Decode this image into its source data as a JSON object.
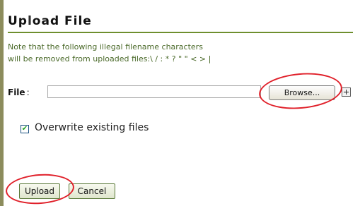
{
  "title": "Upload File",
  "note": {
    "line1": "Note that the following illegal filename characters",
    "line2": "will be removed from uploaded files:\\ / : * ? \" \" < > |"
  },
  "file": {
    "label": "File",
    "colon": ":",
    "value": "",
    "browse_label": "Browse..."
  },
  "overwrite": {
    "checked": true,
    "check_glyph": "✔",
    "label": "Overwrite existing files"
  },
  "actions": {
    "upload_label": "Upload",
    "cancel_label": "Cancel"
  },
  "colors": {
    "title_rule": "#6e8f2e",
    "note_text": "#4b6a2a",
    "highlight_circle": "#e0202a"
  },
  "icons": {
    "expand": "expand-plus-icon",
    "cursor": "text-cursor-icon"
  }
}
